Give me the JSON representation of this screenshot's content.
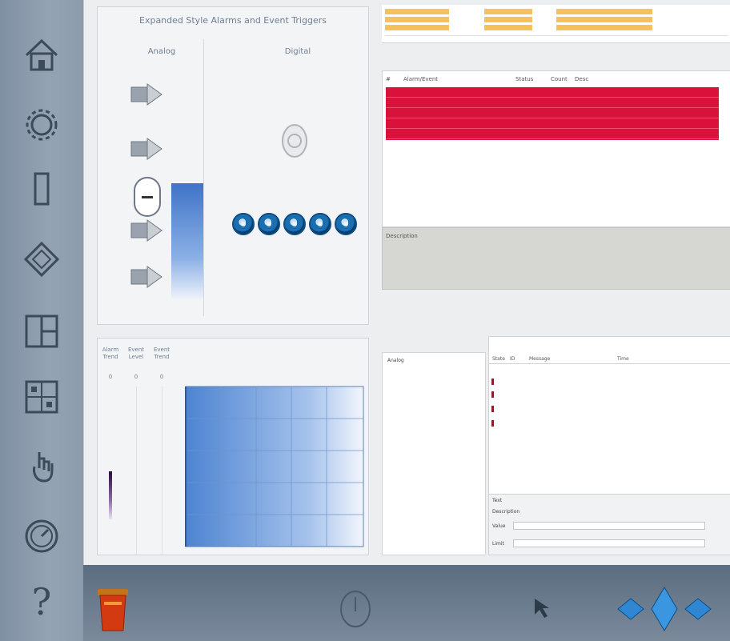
{
  "colors": {
    "accent_blue": "#3f74c8",
    "alarm_red": "#d8123b",
    "panel_bg": "#eceeef",
    "rail_bg": "#8595a6",
    "chip_orange": "#f6c15b"
  },
  "rail": {
    "items": [
      {
        "icon": "home-icon"
      },
      {
        "icon": "gear-icon"
      },
      {
        "icon": "rectangle-icon"
      },
      {
        "icon": "diamond-icon"
      },
      {
        "icon": "window-layout-icon"
      },
      {
        "icon": "grid-icon"
      },
      {
        "icon": "hand-pointer-icon"
      },
      {
        "icon": "gauge-icon"
      },
      {
        "icon": "help-icon"
      }
    ],
    "help_label": "?"
  },
  "top_panel": {
    "title": "Expanded Style Alarms and Event Triggers",
    "analog_label": "Analog",
    "digital_label": "Digital",
    "digital_level": 0.0
  },
  "chart_panel": {
    "labels": [
      "Alarm Trend",
      "Event Level",
      "Event Trend"
    ],
    "ticks": [
      "0",
      "0",
      "0"
    ],
    "x_ticks": [
      "",
      "",
      "",
      "",
      "",
      ""
    ]
  },
  "alarm_table": {
    "toolbar_rows": [
      {
        "a": "",
        "b": "",
        "c": ""
      },
      {
        "a": "",
        "b": "",
        "c": ""
      },
      {
        "a": "",
        "b": "",
        "c": ""
      }
    ],
    "headers": [
      "#",
      "Alarm/Event",
      "Status",
      "Count",
      "Desc"
    ],
    "rows": [
      {
        "num": "",
        "name": "",
        "status": "",
        "count": "",
        "desc": ""
      },
      {
        "num": "",
        "name": "",
        "status": "",
        "count": "",
        "desc": ""
      },
      {
        "num": "",
        "name": "",
        "status": "",
        "count": "",
        "desc": ""
      },
      {
        "num": "",
        "name": "",
        "status": "",
        "count": "",
        "desc": ""
      },
      {
        "num": "",
        "name": "",
        "status": "",
        "count": "",
        "desc": ""
      }
    ]
  },
  "detail_band": {
    "label": "Description"
  },
  "mid_toolbar": {
    "title": "",
    "status_items": [
      "",
      "",
      "",
      ""
    ]
  },
  "tree": {
    "items": [
      "Analog",
      "",
      "",
      ""
    ]
  },
  "list_panel": {
    "title": "",
    "headers": [
      "State",
      "ID",
      "Message",
      "Time"
    ],
    "rows": [
      {
        "msg": "",
        "time": ""
      },
      {
        "msg": "",
        "time": ""
      },
      {
        "msg": "",
        "time": ""
      },
      {
        "msg": "",
        "time": ""
      },
      {
        "msg": "",
        "time": ""
      },
      {
        "msg": "",
        "time": ""
      },
      {
        "msg": "",
        "time": ""
      },
      {
        "msg": "",
        "time": ""
      },
      {
        "msg": "",
        "time": ""
      }
    ],
    "footer": {
      "label1": "Text",
      "label2": "Description",
      "field1_label": "Value",
      "field2_label": "Limit"
    }
  },
  "bottom_bar": {
    "icons": [
      "trash-icon",
      "power-icon",
      "pointer-icon",
      "arrow-navigation-icon"
    ]
  }
}
